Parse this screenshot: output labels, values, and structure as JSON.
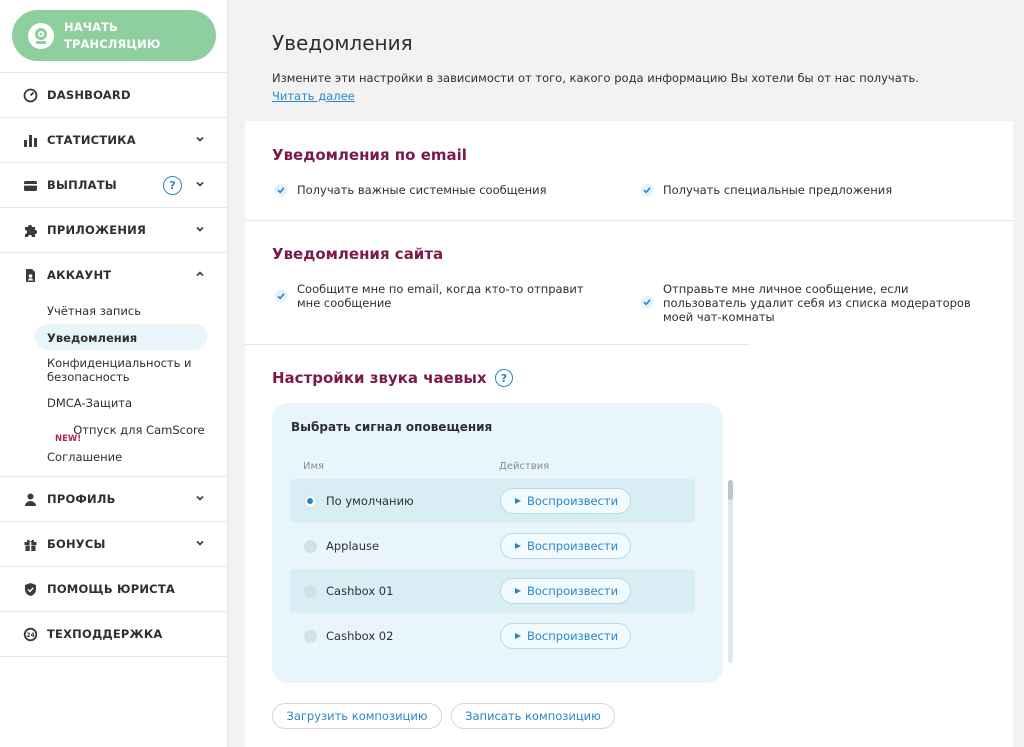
{
  "sidebar": {
    "start_button": "НАЧАТЬ\nТРАНСЛЯЦИЮ",
    "items": [
      {
        "label": "DASHBOARD",
        "icon": "dashboard-gauge-icon"
      },
      {
        "label": "СТАТИСТИКА",
        "icon": "bar-chart-icon"
      },
      {
        "label": "ВЫПЛАТЫ",
        "icon": "credit-card-icon"
      },
      {
        "label": "ПРИЛОЖЕНИЯ",
        "icon": "puzzle-icon"
      },
      {
        "label": "АККАУНТ",
        "icon": "document-user-icon"
      },
      {
        "label": "ПРОФИЛЬ",
        "icon": "person-icon"
      },
      {
        "label": "БОНУСЫ",
        "icon": "gift-icon"
      },
      {
        "label": "ПОМОЩЬ ЮРИСТА",
        "icon": "shield-icon"
      },
      {
        "label": "ТЕХПОДДЕРЖКА",
        "icon": "support-icon"
      }
    ],
    "help_glyph": "?",
    "account_sub": [
      {
        "label": "Учётная запись"
      },
      {
        "label": "Уведомления"
      },
      {
        "label": "Конфиденциальность и безопасность"
      },
      {
        "label": "DMCA-Защита"
      },
      {
        "label": "Отпуск для CamScore"
      },
      {
        "label": "Соглашение"
      }
    ],
    "new_badge": "NEW!"
  },
  "page": {
    "title": "Уведомления",
    "intro": "Измените эти настройки в зависимости от того, какого рода информацию Вы хотели бы от нас получать. ",
    "read_more": "Читать далее"
  },
  "email_section": {
    "title": "Уведомления по email",
    "options": [
      "Получать важные системные сообщения",
      "Получать специальные предложения"
    ]
  },
  "site_section": {
    "title": "Уведомления сайта",
    "options": [
      "Сообщите мне по email, когда кто-то отправит мне сообщение",
      "Отправьте мне личное сообщение, если пользователь удалит себя из списка модераторов моей чат-комнаты"
    ]
  },
  "sound_section": {
    "title": "Настройки звука чаевых",
    "help_glyph": "?",
    "box_title": "Выбрать сигнал оповещения",
    "col_name": "Имя",
    "col_actions": "Действия",
    "play_label": "Воспроизвести",
    "sounds": [
      {
        "name": "По умолчанию",
        "selected": true
      },
      {
        "name": "Applause",
        "selected": false
      },
      {
        "name": "Cashbox 01",
        "selected": false
      },
      {
        "name": "Cashbox 02",
        "selected": false
      }
    ],
    "upload_label": "Загрузить композицию",
    "record_label": "Записать композицию"
  },
  "colors": {
    "accent": "#2a86c8",
    "section_title": "#7a1b4a",
    "start_button": "#8fce9e",
    "new_badge": "#b0284e"
  }
}
